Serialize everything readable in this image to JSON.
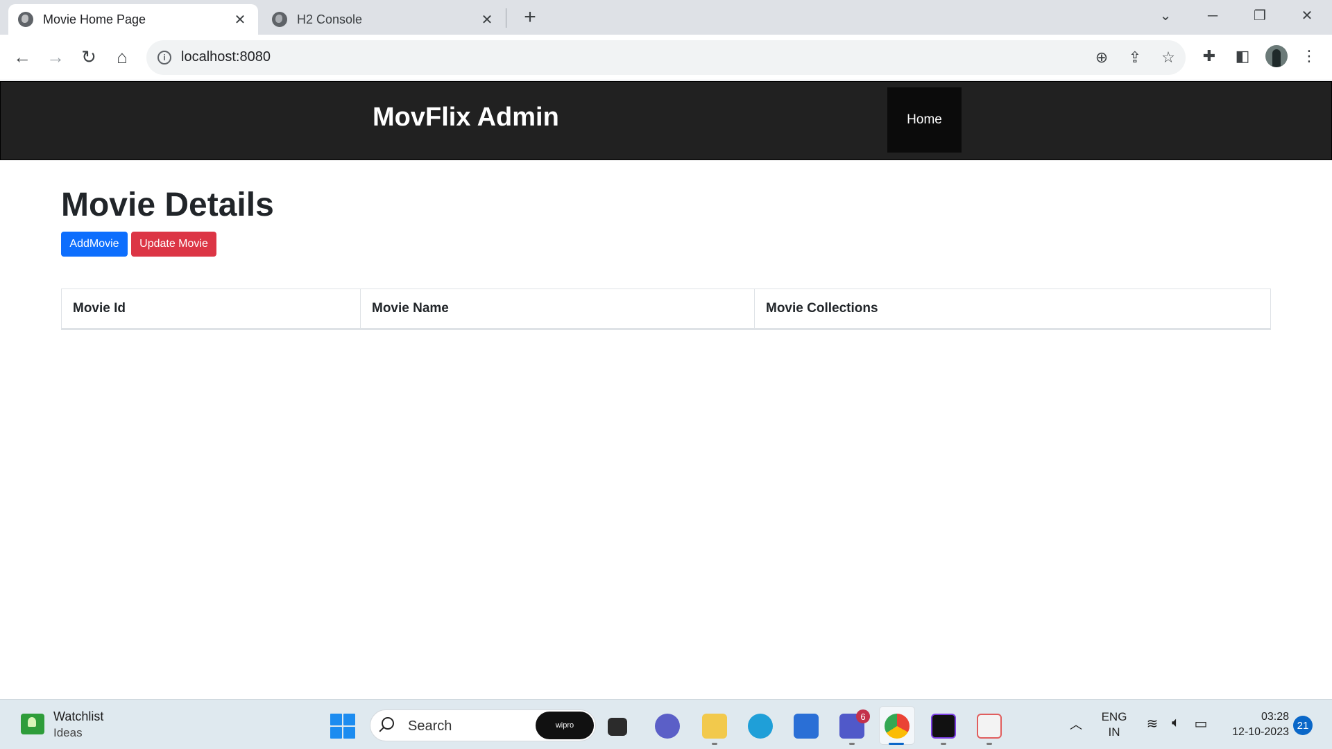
{
  "browser": {
    "tabs": [
      {
        "title": "Movie Home Page",
        "active": true
      },
      {
        "title": "H2 Console",
        "active": false
      }
    ],
    "url": "localhost:8080"
  },
  "navbar": {
    "brand": "MovFlix Admin",
    "links": [
      {
        "label": "Home"
      }
    ]
  },
  "main": {
    "title": "Movie Details",
    "buttons": {
      "add_label": "AddMovie",
      "update_label": "Update Movie"
    },
    "table": {
      "columns": [
        "Movie Id",
        "Movie Name",
        "Movie Collections"
      ],
      "rows": []
    }
  },
  "taskbar": {
    "widget": {
      "title": "Watchlist",
      "subtitle": "Ideas"
    },
    "search_label": "Search",
    "search_badge": "wipro",
    "teams_badge": "6",
    "language": {
      "line1": "ENG",
      "line2": "IN"
    },
    "clock": {
      "time": "03:28",
      "date": "12-10-2023"
    },
    "notification_count": "21"
  },
  "colors": {
    "navbar_bg": "#212121",
    "primary": "#0d6efd",
    "danger": "#dc3545"
  }
}
